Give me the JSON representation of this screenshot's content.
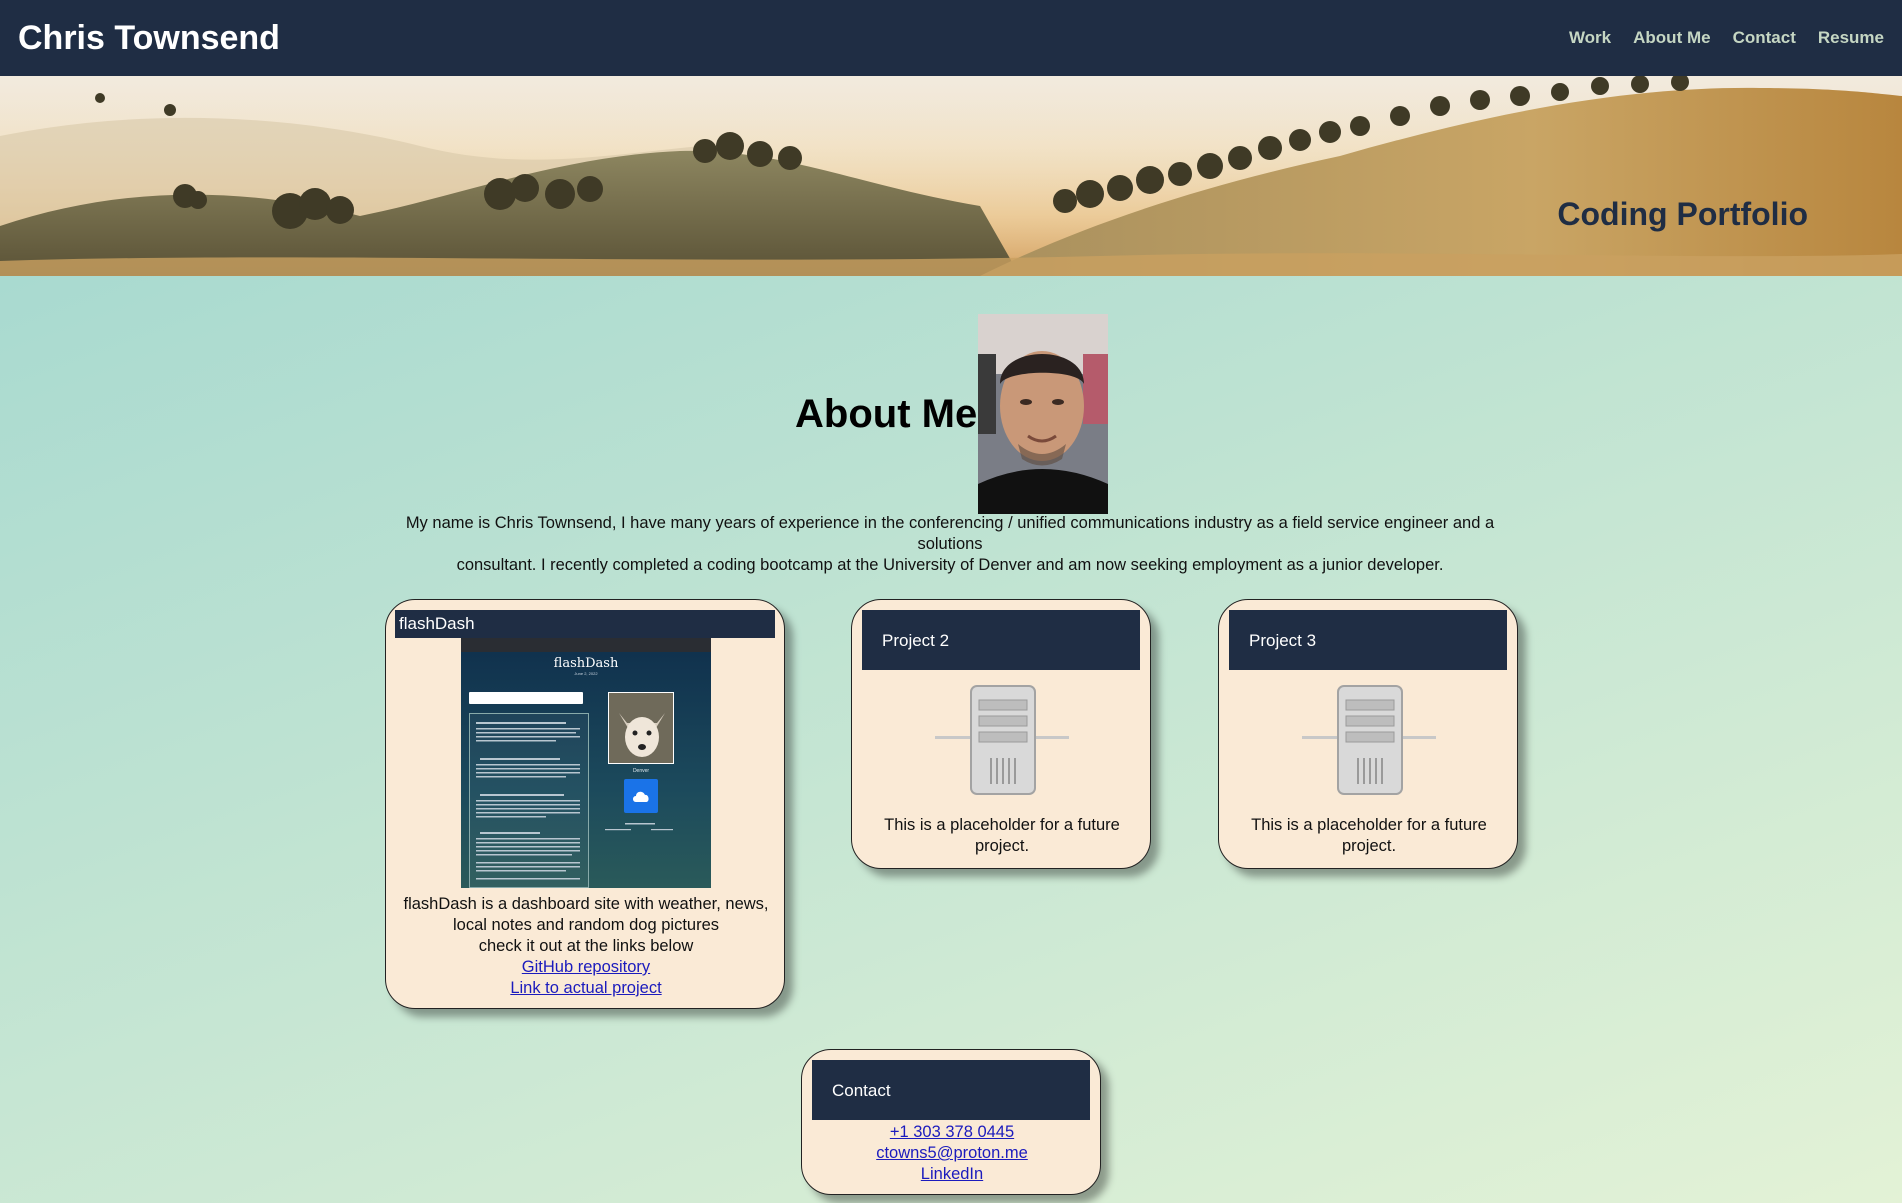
{
  "header": {
    "brand": "Chris Townsend",
    "nav": [
      "Work",
      "About Me",
      "Contact",
      "Resume"
    ]
  },
  "hero": {
    "title": "Coding Portfolio"
  },
  "about": {
    "heading": "About Me",
    "line1": "My name is Chris Townsend, I have many years of experience in the conferencing / unified communications industry as a field service engineer and a solutions",
    "line2": "consultant. I recently completed a coding bootcamp at the University of Denver and am now seeking employment as a junior developer."
  },
  "projects": [
    {
      "title": "flashDash",
      "screenshot": {
        "title": "flashDash",
        "date": "June 2, 2022",
        "city": "Denver"
      },
      "desc1": "flashDash is a dashboard site with weather, news,",
      "desc2": "local notes and random dog pictures",
      "desc3": "check it out at the links below",
      "link1": "GitHub repository",
      "link2": "Link to actual project"
    },
    {
      "title": "Project 2",
      "desc1": "This is a placeholder for a future",
      "desc2": "project."
    },
    {
      "title": "Project 3",
      "desc1": "This is a placeholder for a future",
      "desc2": "project."
    }
  ],
  "contact": {
    "title": "Contact",
    "phone": "+1 303 378 0445",
    "email": "ctowns5@proton.me",
    "linkedin": "LinkedIn"
  },
  "colors": {
    "navy": "#1f2d44",
    "card_bg": "#faead6",
    "link": "#1b1bbd",
    "nav_link": "#c5d6c3"
  }
}
